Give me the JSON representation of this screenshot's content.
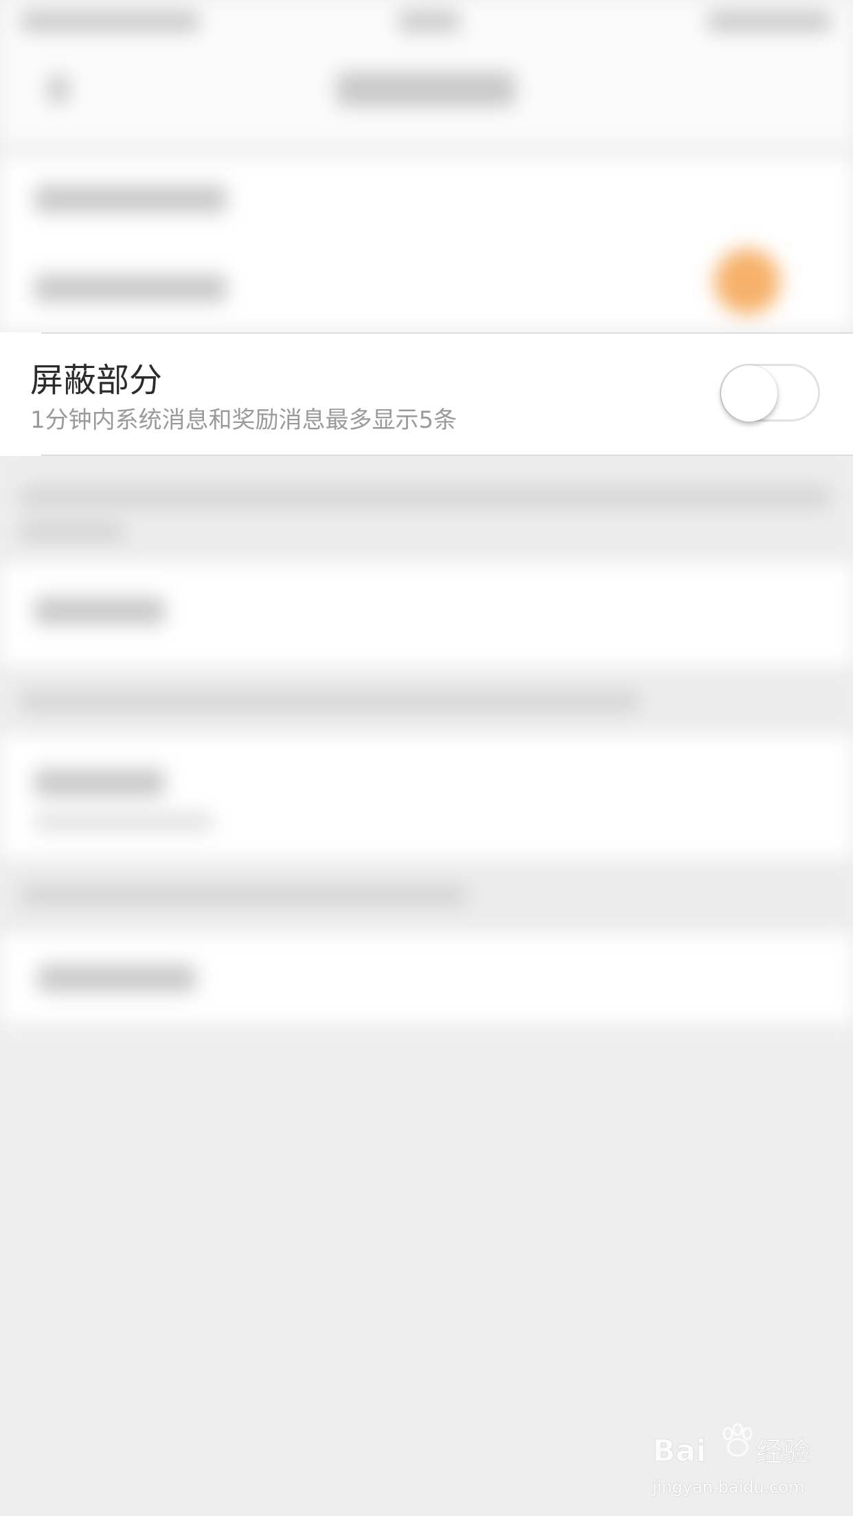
{
  "setting_row": {
    "title": "屏蔽部分",
    "subtitle": "1分钟内系统消息和奖励消息最多显示5条",
    "toggle_on": false
  },
  "watermark": {
    "brand": "Baidu经验",
    "url": "jingyan.baidu.com"
  },
  "colors": {
    "background": "#eeeeee",
    "accent_orange": "#f6b26b",
    "title_text": "#2b2b2b",
    "subtitle_text": "#9a9a9a"
  }
}
